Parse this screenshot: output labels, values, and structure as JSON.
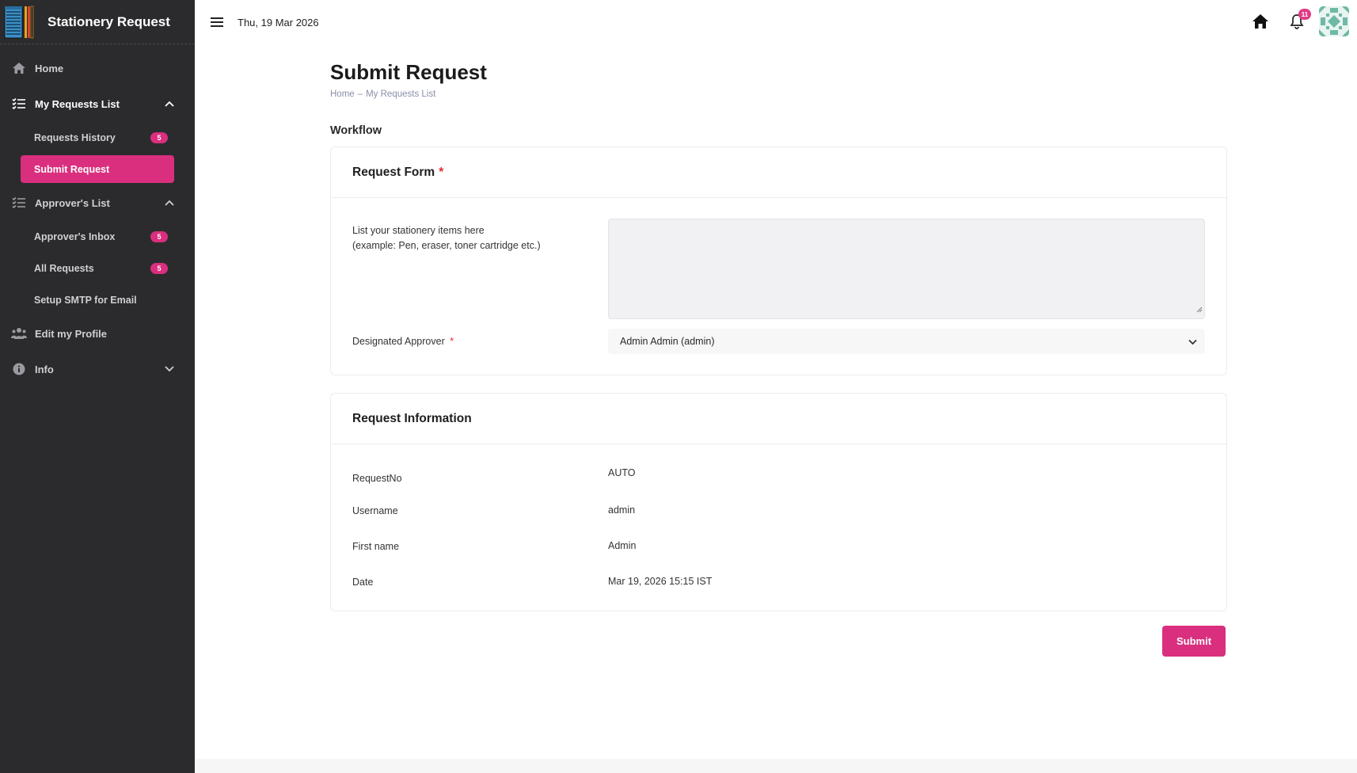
{
  "app": {
    "title": "Stationery Request",
    "date": "Thu, 19 Mar 2026",
    "notification_count": "11"
  },
  "colors": {
    "accent": "#d92f7e",
    "sidebar_bg": "#2b2b2d",
    "required": "#e02c2c"
  },
  "sidebar": {
    "home": "Home",
    "my_requests": "My Requests List",
    "requests_history": "Requests History",
    "requests_history_badge": "5",
    "submit_request": "Submit Request",
    "approvers_list": "Approver's List",
    "approvers_inbox": "Approver's Inbox",
    "approvers_inbox_badge": "5",
    "all_requests": "All Requests",
    "all_requests_badge": "5",
    "setup_smtp": "Setup SMTP for Email",
    "edit_profile": "Edit my Profile",
    "info": "Info"
  },
  "page": {
    "title": "Submit Request",
    "breadcrumb_home": "Home",
    "breadcrumb_sep": "–",
    "breadcrumb_current": "My Requests List",
    "section": "Workflow"
  },
  "request_form": {
    "title": "Request Form",
    "required_mark": "*",
    "items_label_line1": "List your stationery items here",
    "items_label_line2": "(example: Pen, eraser, toner cartridge etc.)",
    "items_value": "",
    "approver_label": "Designated Approver",
    "approver_required_mark": "*",
    "approver_value": "Admin Admin (admin)"
  },
  "request_info": {
    "title": "Request Information",
    "rows": [
      {
        "label": "RequestNo",
        "value": "AUTO"
      },
      {
        "label": "Username",
        "value": "admin"
      },
      {
        "label": "First name",
        "value": "Admin"
      },
      {
        "label": "Date",
        "value": "Mar 19, 2026 15:15 IST"
      }
    ]
  },
  "actions": {
    "submit": "Submit"
  }
}
